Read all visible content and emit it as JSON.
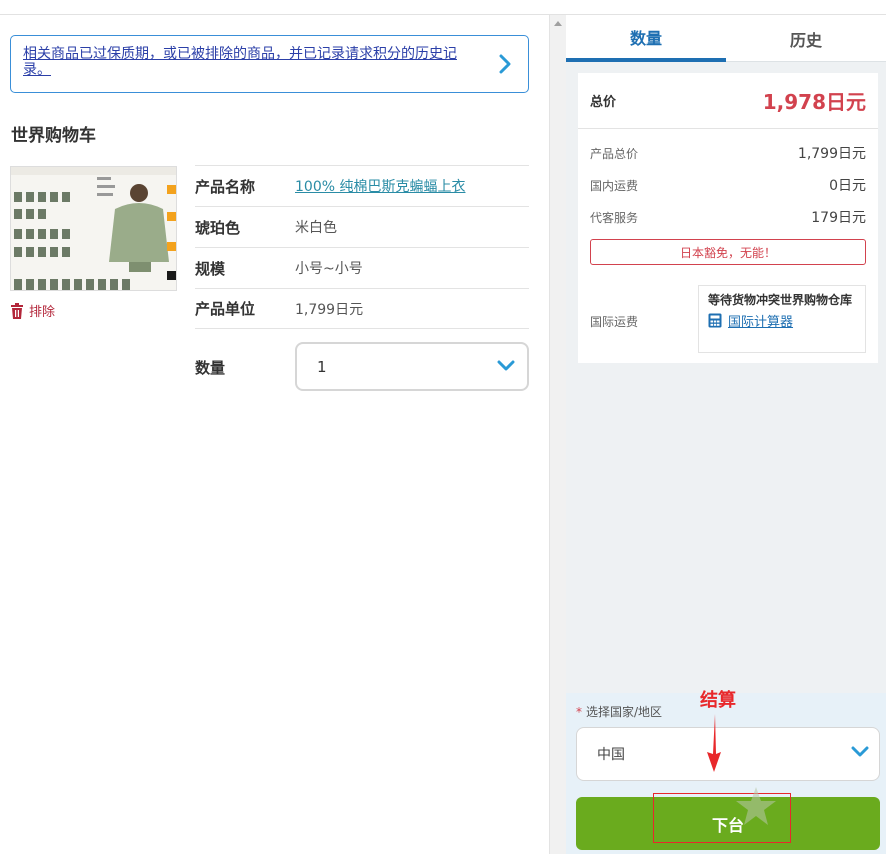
{
  "notice": {
    "link_text": "相关商品已过保质期，或已被排除的商品，并已记录请求积分的历史记录。"
  },
  "cart": {
    "title": "世界购物车",
    "remove_label": "排除",
    "product": {
      "name_label": "产品名称",
      "name_value": "100% 纯棉巴斯克蝙蝠上衣",
      "color_label": "琥珀色",
      "color_value": "米白色",
      "size_label": "规模",
      "size_value": "小号~小号",
      "unit_label": "产品单位",
      "unit_value": "1,799日元"
    },
    "quantity_label": "数量",
    "quantity_value": "1"
  },
  "sidebar": {
    "tabs": [
      {
        "label": "数量",
        "active": true
      },
      {
        "label": "历史",
        "active": false
      }
    ],
    "total_label": "总价",
    "total_value": "1,978日元",
    "lines": [
      {
        "label": "产品总价",
        "value": "1,799日元"
      },
      {
        "label": "国内运费",
        "value": "0日元"
      },
      {
        "label": "代客服务",
        "value": "179日元"
      }
    ],
    "warning": "日本豁免，无能！",
    "intl_label": "国际运费",
    "intl_wait": "等待货物冲突世界购物仓库",
    "intl_calc": "国际计算器",
    "country_label": "选择国家/地区",
    "required_mark": "*",
    "country_value": "中国",
    "order_button": "下台"
  },
  "annotation": {
    "text": "结算",
    "color": "#e8282b"
  },
  "colors": {
    "accent": "#1e6fb2",
    "price": "#d2424e",
    "order_button": "#6aab1e"
  }
}
